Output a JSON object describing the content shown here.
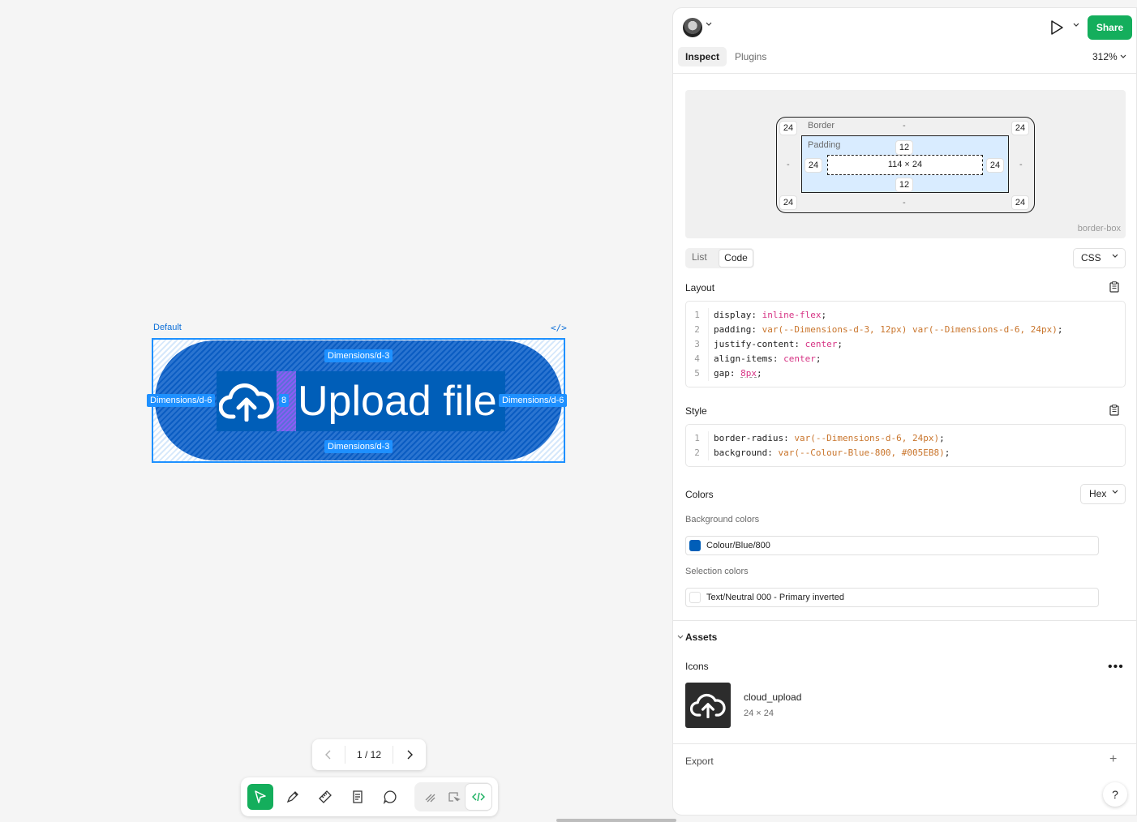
{
  "canvas": {
    "frame_label": "Default",
    "code_tag": "</>",
    "button": {
      "label": "Upload file",
      "icon": "cloud-upload-icon",
      "background": "#005EB8"
    },
    "measurements": {
      "top": "Dimensions/d-3",
      "bottom": "Dimensions/d-3",
      "left": "Dimensions/d-6",
      "right": "Dimensions/d-6",
      "gap": "8"
    },
    "pager": {
      "text": "1 / 12"
    }
  },
  "toolbar": {
    "tools": [
      "move-tool",
      "pen-tool",
      "ruler-tool",
      "note-tool",
      "comment-tool",
      "draw-tool",
      "component-tool",
      "dev-mode-tool"
    ],
    "active": "move-tool"
  },
  "panel": {
    "header": {
      "share_label": "Share",
      "tabs": [
        "Inspect",
        "Plugins"
      ],
      "active_tab": "Inspect",
      "zoom": "312%"
    },
    "box_model": {
      "border_label": "Border",
      "padding_label": "Padding",
      "content_size": "114 × 24",
      "corner_radius": {
        "tl": "24",
        "tr": "24",
        "bl": "24",
        "br": "24"
      },
      "border": {
        "top": "-",
        "bottom": "-",
        "left": "-",
        "right": "-"
      },
      "padding": {
        "top": "12",
        "bottom": "12",
        "left": "24",
        "right": "24"
      },
      "box_sizing": "border-box"
    },
    "view_toggle": {
      "list": "List",
      "code": "Code",
      "active": "Code"
    },
    "language": "CSS",
    "layout": {
      "title": "Layout",
      "lines": [
        {
          "n": "1",
          "prop": "display",
          "value": "inline-flex"
        },
        {
          "n": "2",
          "prop": "padding",
          "value": "var(--Dimensions-d-3, 12px) var(--Dimensions-d-6, 24px)"
        },
        {
          "n": "3",
          "prop": "justify-content",
          "value": "center"
        },
        {
          "n": "4",
          "prop": "align-items",
          "value": "center"
        },
        {
          "n": "5",
          "prop": "gap",
          "value": "8px"
        }
      ]
    },
    "style": {
      "title": "Style",
      "lines": [
        {
          "n": "1",
          "prop": "border-radius",
          "value": "var(--Dimensions-d-6, 24px)"
        },
        {
          "n": "2",
          "prop": "background",
          "value": "var(--Colour-Blue-800, #005EB8)"
        }
      ]
    },
    "colors": {
      "title": "Colors",
      "format": "Hex",
      "background_title": "Background colors",
      "background": {
        "name": "Colour/Blue/800",
        "swatch": "#005EB8"
      },
      "selection_title": "Selection colors",
      "selection": {
        "name": "Text/Neutral 000 - Primary inverted",
        "swatch": "#FFFFFF"
      }
    },
    "assets": {
      "title": "Assets",
      "icons_title": "Icons",
      "icon": {
        "name": "cloud_upload",
        "size": "24 × 24"
      }
    },
    "export_title": "Export",
    "help": "?"
  }
}
